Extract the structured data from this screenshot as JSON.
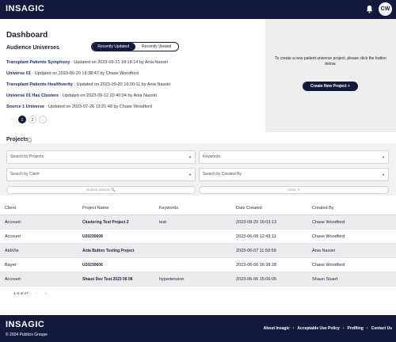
{
  "header": {
    "logo_text": "INSAGIC",
    "avatar_initials": "CW"
  },
  "dashboard": {
    "title": "Dashboard",
    "audience_title": "Audience Universes",
    "toggle": [
      "Recently Updated",
      "Recently Viewed"
    ],
    "universes": [
      {
        "name": "Transplant Patients Symphony",
        "meta": " · Updated on 2023-09-21 18:18:14 by Ania Nassiri"
      },
      {
        "name": "Universe 01",
        "meta": " · Updated on 2023-09-20 18:38:47 by Chase Woodford"
      },
      {
        "name": "Transplant Patients Healthverity",
        "meta": " · Updated on 2023-09-20 16:00:11 by Ania Nassiri"
      },
      {
        "name": "Universe 01 Has Clusters",
        "meta": " · Updated on 2023-09-12 20:40:04 by Ania Nassiri"
      },
      {
        "name": "Source 1 Universe",
        "meta": " · Updated on 2023-07-26 13:21:48 by Chase Woodford"
      }
    ],
    "pages": [
      "1",
      "2"
    ]
  },
  "panel": {
    "text": "To create a new patient universe project, please click the button below.",
    "button": "Create New Project +"
  },
  "projects": {
    "title": "Projects",
    "search_projects": "Search by Projects",
    "keywords": "Keywords",
    "search_client": "Search by Client",
    "search_created_by": "Search by Created By",
    "submit": "Submit Search 🔍",
    "clear": "Clear ✕",
    "columns": [
      "Client",
      "Project Name",
      "Keywords",
      "Date Created",
      "Created By"
    ],
    "rows": [
      [
        "Account",
        "Clustering Test Project 2",
        "test",
        "2023-09-20 16:03:13",
        "Chase Woodford"
      ],
      [
        "Account",
        "U20230608",
        "",
        "2023-06-08 12:43:11",
        "Chase Woodford"
      ],
      [
        "AbbVie",
        "Ania Button Testing Project",
        "",
        "2023-06-07 11:50:59",
        "Ania Nassiri"
      ],
      [
        "Bayer",
        "U20230606",
        "",
        "2023-06-06 16:38:28",
        "Chase Woodford"
      ],
      [
        "Account",
        "Shaun Dev Test 2023 06 06",
        "hypertension",
        "2023-06-06 15:06:05",
        "Shaun Stuart"
      ]
    ],
    "range": "1–5 of 27"
  },
  "footer": {
    "logo_text": "INSAGIC",
    "copyright": "© 2024 Publicis Groupe",
    "links": [
      "About Insagic",
      "Acceptable Use Policy",
      "Profiling",
      "Contact Us"
    ]
  }
}
